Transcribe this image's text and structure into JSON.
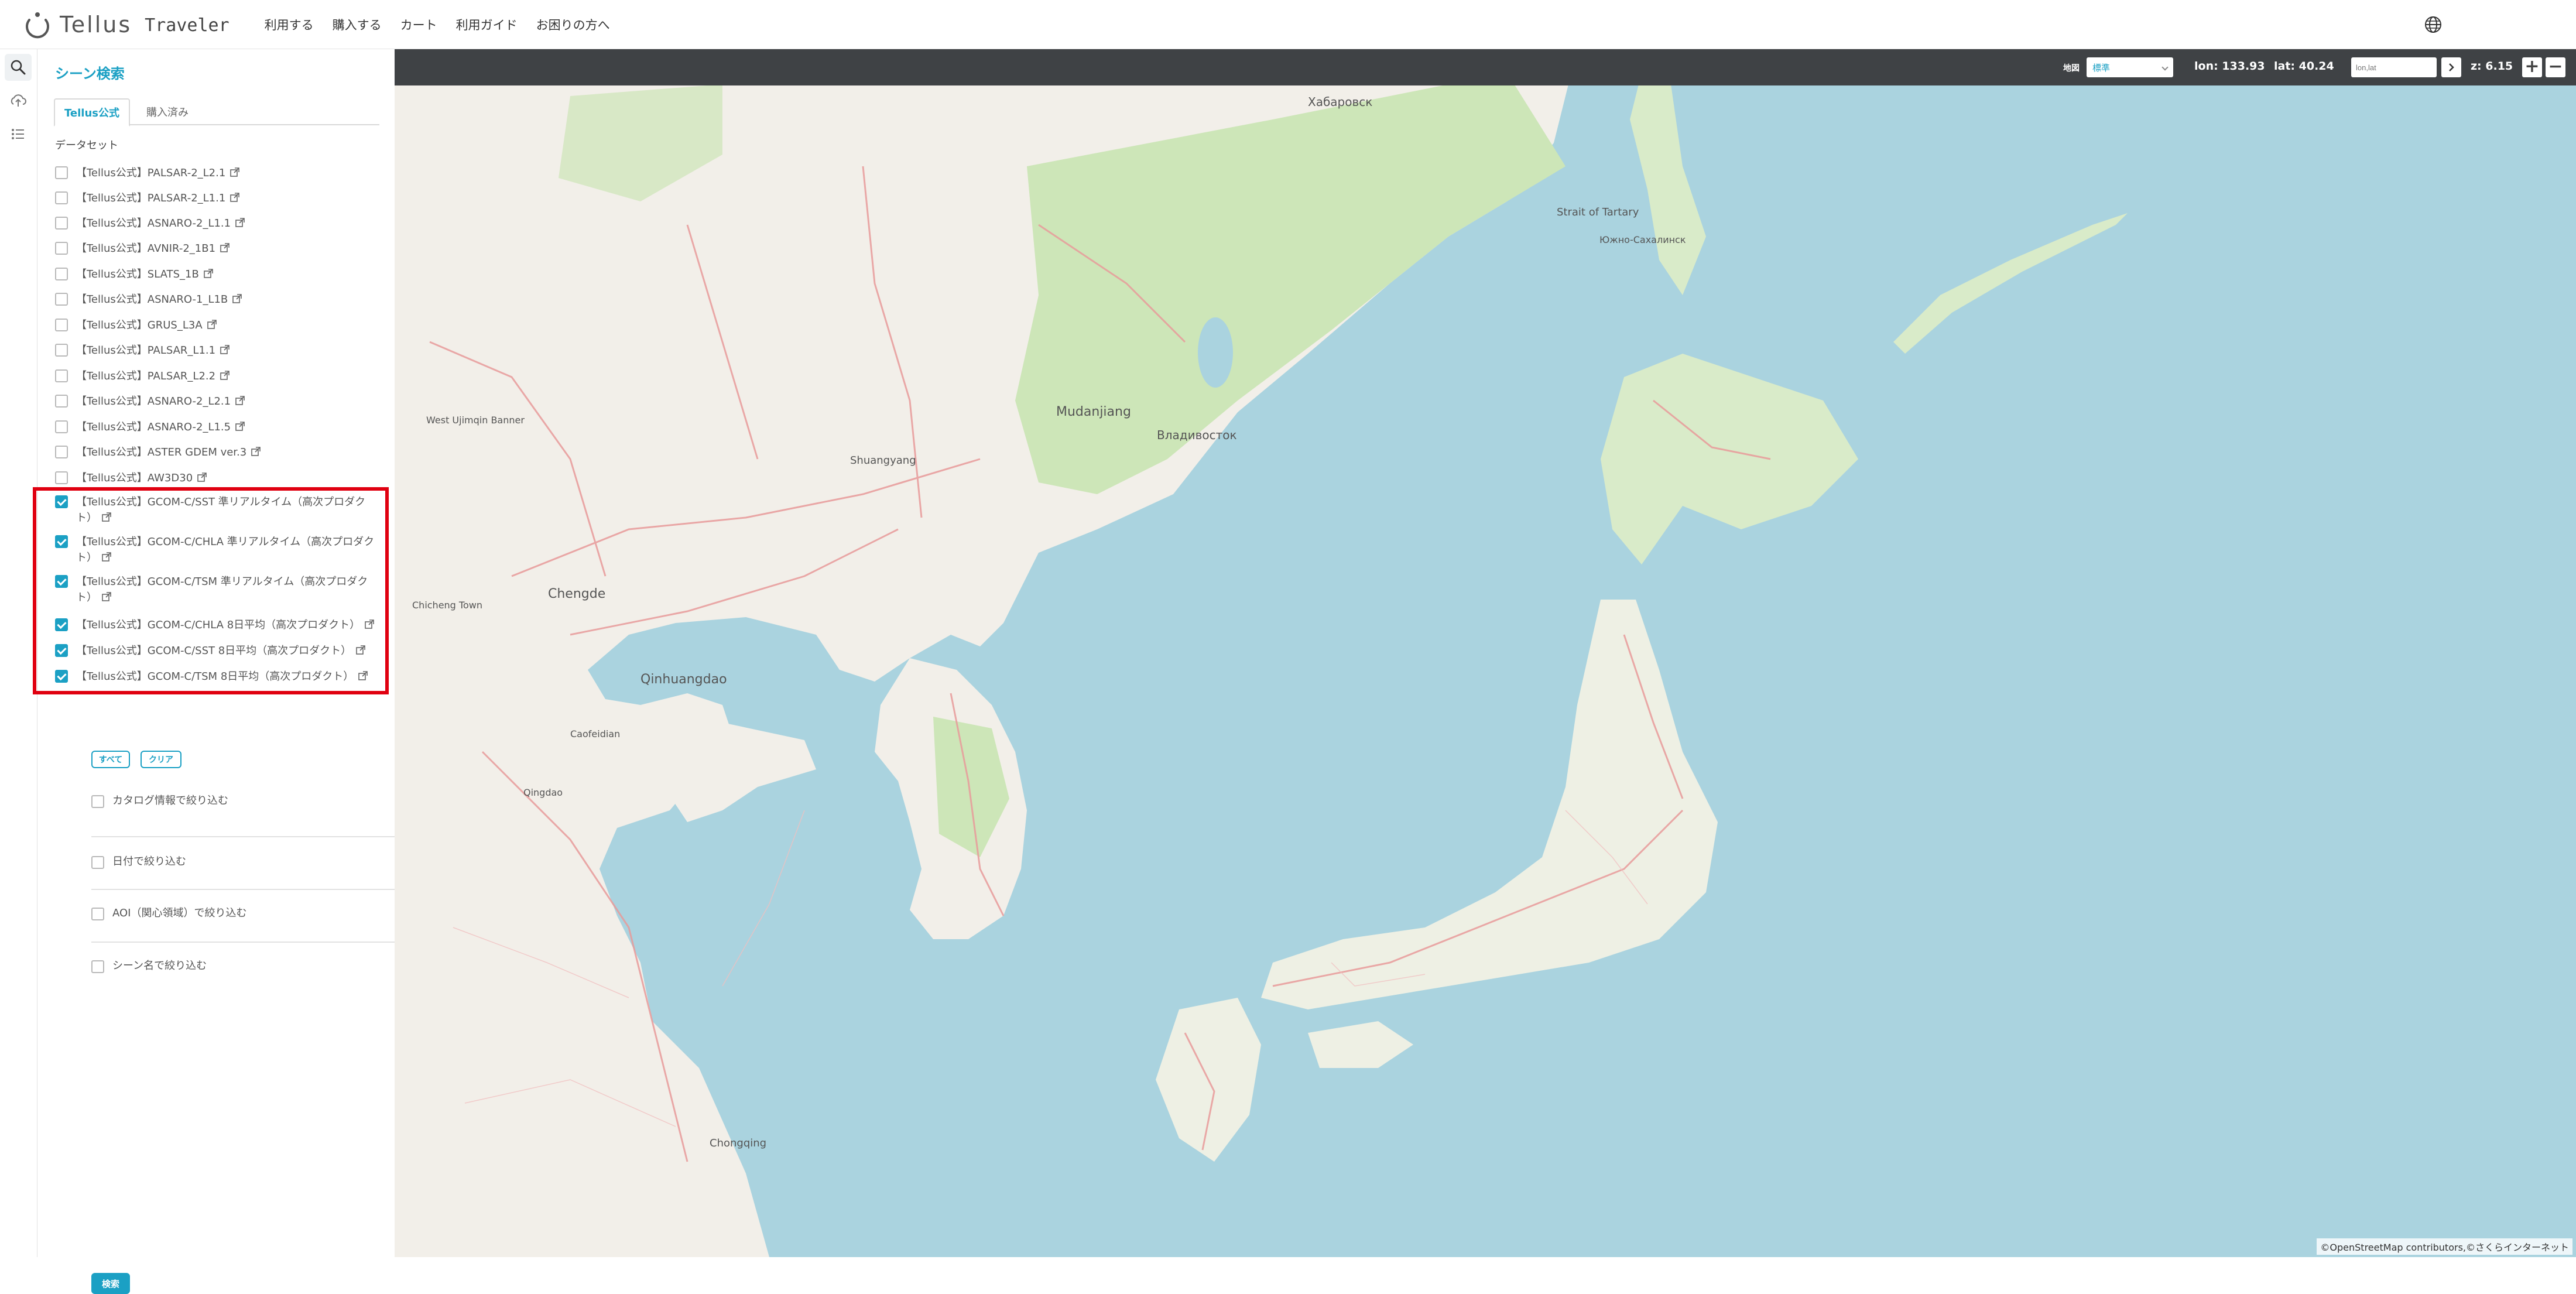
{
  "header": {
    "logo_text": "Tellus",
    "logo_sub": "Traveler",
    "nav": [
      "利用する",
      "購入する",
      "カート",
      "利用ガイド",
      "お困りの方へ"
    ]
  },
  "rail": {
    "icons": [
      "search-icon",
      "upload-icon",
      "list-icon"
    ]
  },
  "panel": {
    "title": "シーン検索",
    "tabs": [
      "Tellus公式",
      "購入済み"
    ],
    "dataset_label": "データセット",
    "datasets": [
      {
        "label": "【Tellus公式】PALSAR-2_L2.1",
        "checked": false
      },
      {
        "label": "【Tellus公式】PALSAR-2_L1.1",
        "checked": false
      },
      {
        "label": "【Tellus公式】ASNARO-2_L1.1",
        "checked": false
      },
      {
        "label": "【Tellus公式】AVNIR-2_1B1",
        "checked": false
      },
      {
        "label": "【Tellus公式】SLATS_1B",
        "checked": false
      },
      {
        "label": "【Tellus公式】ASNARO-1_L1B",
        "checked": false
      },
      {
        "label": "【Tellus公式】GRUS_L3A",
        "checked": false
      },
      {
        "label": "【Tellus公式】PALSAR_L1.1",
        "checked": false
      },
      {
        "label": "【Tellus公式】PALSAR_L2.2",
        "checked": false
      },
      {
        "label": "【Tellus公式】ASNARO-2_L2.1",
        "checked": false
      },
      {
        "label": "【Tellus公式】ASNARO-2_L1.5",
        "checked": false
      },
      {
        "label": "【Tellus公式】ASTER GDEM ver.3",
        "checked": false
      },
      {
        "label": "【Tellus公式】AW3D30",
        "checked": false
      },
      {
        "label": "【Tellus公式】GCOM-C/SST 準リアルタイム（高次プロダクト）",
        "checked": true
      },
      {
        "label": "【Tellus公式】GCOM-C/CHLA 準リアルタイム（高次プロダクト）",
        "checked": true
      },
      {
        "label": "【Tellus公式】GCOM-C/TSM 準リアルタイム（高次プロダクト）",
        "checked": true
      },
      {
        "label": "【Tellus公式】GCOM-C/CHLA 8日平均（高次プロダクト）",
        "checked": true
      },
      {
        "label": "【Tellus公式】GCOM-C/SST 8日平均（高次プロダクト）",
        "checked": true
      },
      {
        "label": "【Tellus公式】GCOM-C/TSM 8日平均（高次プロダクト）",
        "checked": true
      }
    ],
    "btn_all": "すべて",
    "btn_clear": "クリア",
    "filters": [
      "カタログ情報で絞り込む",
      "日付で絞り込む",
      "AOI（関心領域）で絞り込む",
      "シーン名で絞り込む"
    ],
    "search_button": "検索"
  },
  "map_toolbar": {
    "basemap_label": "地図",
    "basemap_value": "標準",
    "lon_text": "lon: 133.93",
    "lat_text": "lat: 40.24",
    "lonlat_placeholder": "lon,lat",
    "zoom_text": "z: 6.15",
    "zoom_in": "+",
    "zoom_out": "−"
  },
  "map": {
    "attribution": "©OpenStreetMap contributors,©さくらインターネット",
    "labels": [
      {
        "text": "Хабаровск",
        "size": 20
      },
      {
        "text": "Mudanjiang",
        "size": 22
      },
      {
        "text": "Владивосток",
        "size": 20
      },
      {
        "text": "Chengde",
        "size": 22
      },
      {
        "text": "Qinhuangdao",
        "size": 22
      },
      {
        "text": "Shuangyang",
        "size": 18
      },
      {
        "text": "Strait of Tartary",
        "size": 18
      },
      {
        "text": "Южно-Сахалинск",
        "size": 16
      },
      {
        "text": "Chongqing",
        "size": 18
      },
      {
        "text": "Chicheng Town",
        "size": 16
      },
      {
        "text": "West Ujimqin Banner",
        "size": 16
      },
      {
        "text": "Caofeidian",
        "size": 16
      },
      {
        "text": "Qingdao",
        "size": 16
      }
    ],
    "colors": {
      "water": "#aad3df",
      "land": "#f2efe9",
      "forest": "#cde6b8",
      "road": "#e89a9a"
    }
  }
}
